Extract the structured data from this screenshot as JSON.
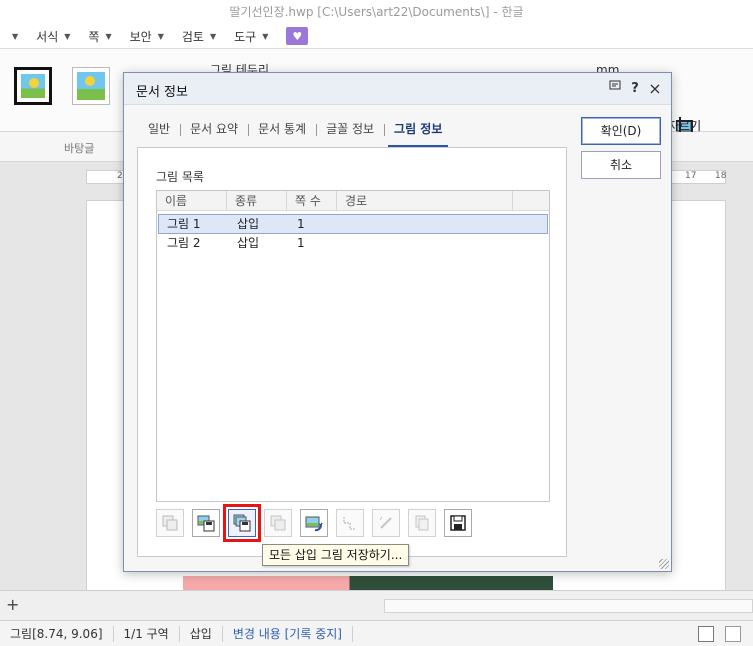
{
  "window": {
    "title": "딸기선인장.hwp [C:\\Users\\art22\\Documents\\] - 한글"
  },
  "menubar": {
    "items": [
      {
        "label": "서식"
      },
      {
        "label": "쪽"
      },
      {
        "label": "보안"
      },
      {
        "label": "검토"
      },
      {
        "label": "도구"
      }
    ]
  },
  "ribbon": {
    "picture_border_label": "그림 테두리",
    "unit_label": "mm",
    "crop_label": "자르기"
  },
  "toolbar2": {
    "background_label": "바탕글"
  },
  "ruler": {
    "left_num": "2",
    "right_nums": [
      "17",
      "18"
    ]
  },
  "dialog": {
    "title": "문서 정보",
    "controls": {
      "help": "?",
      "close": "×"
    },
    "tabs": [
      {
        "label": "일반",
        "active": false
      },
      {
        "label": "문서 요약",
        "active": false
      },
      {
        "label": "문서 통계",
        "active": false
      },
      {
        "label": "글꼴 정보",
        "active": false
      },
      {
        "label": "그림 정보",
        "active": true
      }
    ],
    "list_label": "그림 목록",
    "columns": [
      "이름",
      "종류",
      "쪽 수",
      "경로"
    ],
    "rows": [
      {
        "name": "그림 1",
        "type": "삽입",
        "page": "1",
        "path": "",
        "selected": true
      },
      {
        "name": "그림 2",
        "type": "삽입",
        "page": "1",
        "path": "",
        "selected": false
      }
    ],
    "icon_buttons": [
      {
        "icon": "save-picture-icon",
        "enabled": false
      },
      {
        "icon": "save-selected-picture-icon",
        "enabled": true
      },
      {
        "icon": "save-all-inserted-pictures-icon",
        "enabled": true
      },
      {
        "icon": "copy-picture-icon",
        "enabled": false
      },
      {
        "icon": "replace-picture-icon",
        "enabled": true
      },
      {
        "icon": "picture-path-icon",
        "enabled": false
      },
      {
        "icon": "edit-picture-icon",
        "enabled": false
      },
      {
        "icon": "copy-to-clipboard-icon",
        "enabled": false
      },
      {
        "icon": "floppy-save-icon",
        "enabled": true
      }
    ],
    "tooltip": "모든 삽입 그림 저장하기...",
    "buttons": {
      "ok": "확인(D)",
      "cancel": "취소"
    }
  },
  "statusbar": {
    "items": [
      {
        "label": "그림[8.74, 9.06]"
      },
      {
        "label": "1/1 구역"
      },
      {
        "label": "삽입"
      },
      {
        "label": "변경 내용 [기록 중지]"
      }
    ]
  },
  "colors": {
    "accent": "#2b53b0",
    "selection": "#dde7f8",
    "highlight_box": "#e81414",
    "tooltip_bg": "#fffde8",
    "plugin_menu": "#9b78d8"
  }
}
